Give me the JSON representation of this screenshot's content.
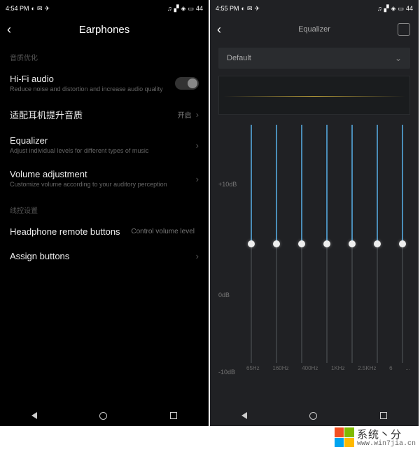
{
  "left": {
    "status": {
      "time": "4:54 PM",
      "battery": "44"
    },
    "title": "Earphones",
    "section1": "音质优化",
    "hifi": {
      "title": "Hi-Fi audio",
      "sub": "Reduce noise and distortion and increase audio quality"
    },
    "adapt": {
      "title": "适配耳机提升音质",
      "value": "开启"
    },
    "eq": {
      "title": "Equalizer",
      "sub": "Adjust individual levels for different types of music"
    },
    "vol": {
      "title": "Volume adjustment",
      "sub": "Customize volume according to your auditory perception"
    },
    "section2": "线控设置",
    "remote": {
      "title": "Headphone remote buttons",
      "value": "Control volume level"
    },
    "assign": {
      "title": "Assign buttons"
    }
  },
  "right": {
    "status": {
      "time": "4:55 PM",
      "battery": "44"
    },
    "title": "Equalizer",
    "preset": "Default",
    "db_plus": "+10dB",
    "db_zero": "0dB",
    "db_minus": "-10dB",
    "freqs": [
      "65Hz",
      "160Hz",
      "400Hz",
      "1KHz",
      "2.5KHz",
      "6",
      "..."
    ]
  },
  "watermark": {
    "text": "系统丶分",
    "url": "www.win7jia.cn"
  }
}
